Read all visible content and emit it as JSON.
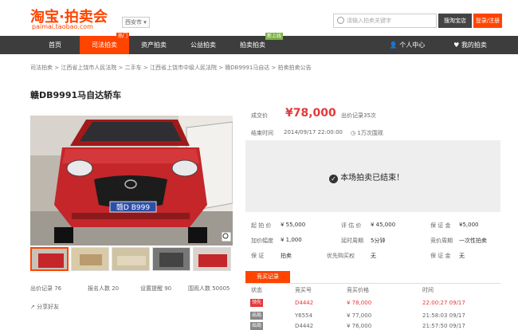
{
  "header": {
    "logo": "淘宝·拍卖会",
    "domain": "paimai.taobao.com",
    "city": "西安市",
    "search_placeholder": "请输入拍卖关键字",
    "search_btn": "搜淘宝店",
    "login_btn": "登录/注册"
  },
  "nav": {
    "items": [
      "首页",
      "司法拍卖",
      "资产拍卖",
      "公益拍卖",
      "拍卖拍卖"
    ],
    "badge_hot": "热门",
    "badge_new": "新上线",
    "right_1": "个人中心",
    "right_2": "我的拍卖"
  },
  "breadcrumb": "司法拍卖 > 江西省上饶市人民法院 > 二手车 > 江西省上饶市中级人民法院 > 赣DB9991马自达 > 拍卖拍卖公告",
  "title": "赣DB9991马自达轿车",
  "plate": "赣D B999",
  "info": {
    "deal_label": "成交价",
    "price": "¥78,000",
    "bids": "出价记录35次",
    "end_label": "结束时间",
    "end_time": "2014/09/17 22:00:00",
    "views": "1万次围观"
  },
  "end_message": "本场拍卖已结束！",
  "details": {
    "c1": [
      [
        "起 拍 价",
        "¥ 55,000"
      ],
      [
        "加价幅度",
        "¥ 1,000"
      ],
      [
        "保    证",
        "拍卖"
      ]
    ],
    "c2": [
      [
        "评 估 价",
        "¥ 45,000"
      ],
      [
        "延时周期",
        "5分钟"
      ],
      [
        "优先购买权",
        "无"
      ]
    ],
    "c3": [
      [
        "保 证 金",
        "¥5,000"
      ],
      [
        "竞价周期",
        "一次性拍卖"
      ],
      [
        "保 证 金",
        "无"
      ]
    ]
  },
  "stats": [
    "出价记录 76",
    "报名人数 20",
    "设置提醒 90",
    "围观人数 50005"
  ],
  "share": "分享好友",
  "record": {
    "tab": "竞买记录",
    "headers": [
      "状态",
      "竞买号",
      "竞买价格",
      "时间"
    ],
    "rows": [
      {
        "status": "领先",
        "id": "D4442",
        "price": "¥ 78,000",
        "time": "22:00:27 09/17",
        "lead": true
      },
      {
        "status": "出局",
        "id": "Y6554",
        "price": "¥ 77,000",
        "time": "21:58:03 09/17",
        "lead": false
      },
      {
        "status": "出局",
        "id": "D4442",
        "price": "¥ 76,000",
        "time": "21:57:50 09/17",
        "lead": false
      }
    ]
  },
  "colors": {
    "accent": "#ff4400",
    "price": "#e4393c",
    "nav": "#3d3d3d"
  }
}
